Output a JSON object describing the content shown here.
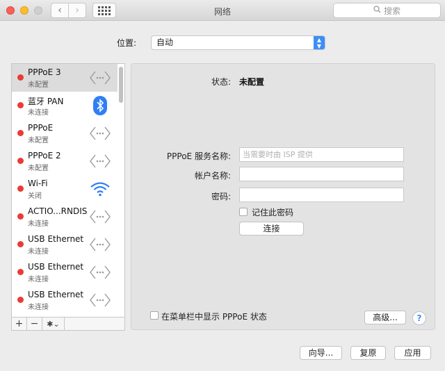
{
  "window": {
    "title": "网络"
  },
  "toolbar": {
    "search_placeholder": "搜索",
    "back_glyph": "‹",
    "forward_glyph": "›"
  },
  "location": {
    "label": "位置:",
    "value": "自动"
  },
  "services": [
    {
      "name": "PPPoE 3",
      "status": "未配置",
      "icon": "ethernet-icon",
      "selected": true
    },
    {
      "name": "蓝牙 PAN",
      "status": "未连接",
      "icon": "bluetooth-icon"
    },
    {
      "name": "PPPoE",
      "status": "未配置",
      "icon": "ethernet-icon"
    },
    {
      "name": "PPPoE 2",
      "status": "未配置",
      "icon": "ethernet-icon"
    },
    {
      "name": "Wi-Fi",
      "status": "关闭",
      "icon": "wifi-icon"
    },
    {
      "name": "ACTIO...RNDIS",
      "status": "未连接",
      "icon": "ethernet-icon"
    },
    {
      "name": "USB Ethernet",
      "status": "未连接",
      "icon": "ethernet-icon"
    },
    {
      "name": "USB Ethernet",
      "status": "未连接",
      "icon": "ethernet-icon"
    },
    {
      "name": "USB Ethernet",
      "status": "未连接",
      "icon": "ethernet-icon"
    }
  ],
  "list_toolbar": {
    "add": "+",
    "remove": "−",
    "gear": "✱⌄"
  },
  "detail": {
    "status_label": "状态:",
    "status_value": "未配置",
    "service_name_label": "PPPoE 服务名称:",
    "service_name_placeholder": "当需要时由 ISP 提供",
    "account_label": "帐户名称:",
    "password_label": "密码:",
    "remember_label": "记住此密码",
    "connect_button": "连接",
    "show_in_menubar_label": "在菜单栏中显示 PPPoE 状态",
    "advanced_button": "高级...",
    "help_button": "?"
  },
  "footer": {
    "assist_button": "向导...",
    "revert_button": "复原",
    "apply_button": "应用"
  },
  "colors": {
    "status_dot": "#ea3b34",
    "accent": "#3b8ef7"
  }
}
